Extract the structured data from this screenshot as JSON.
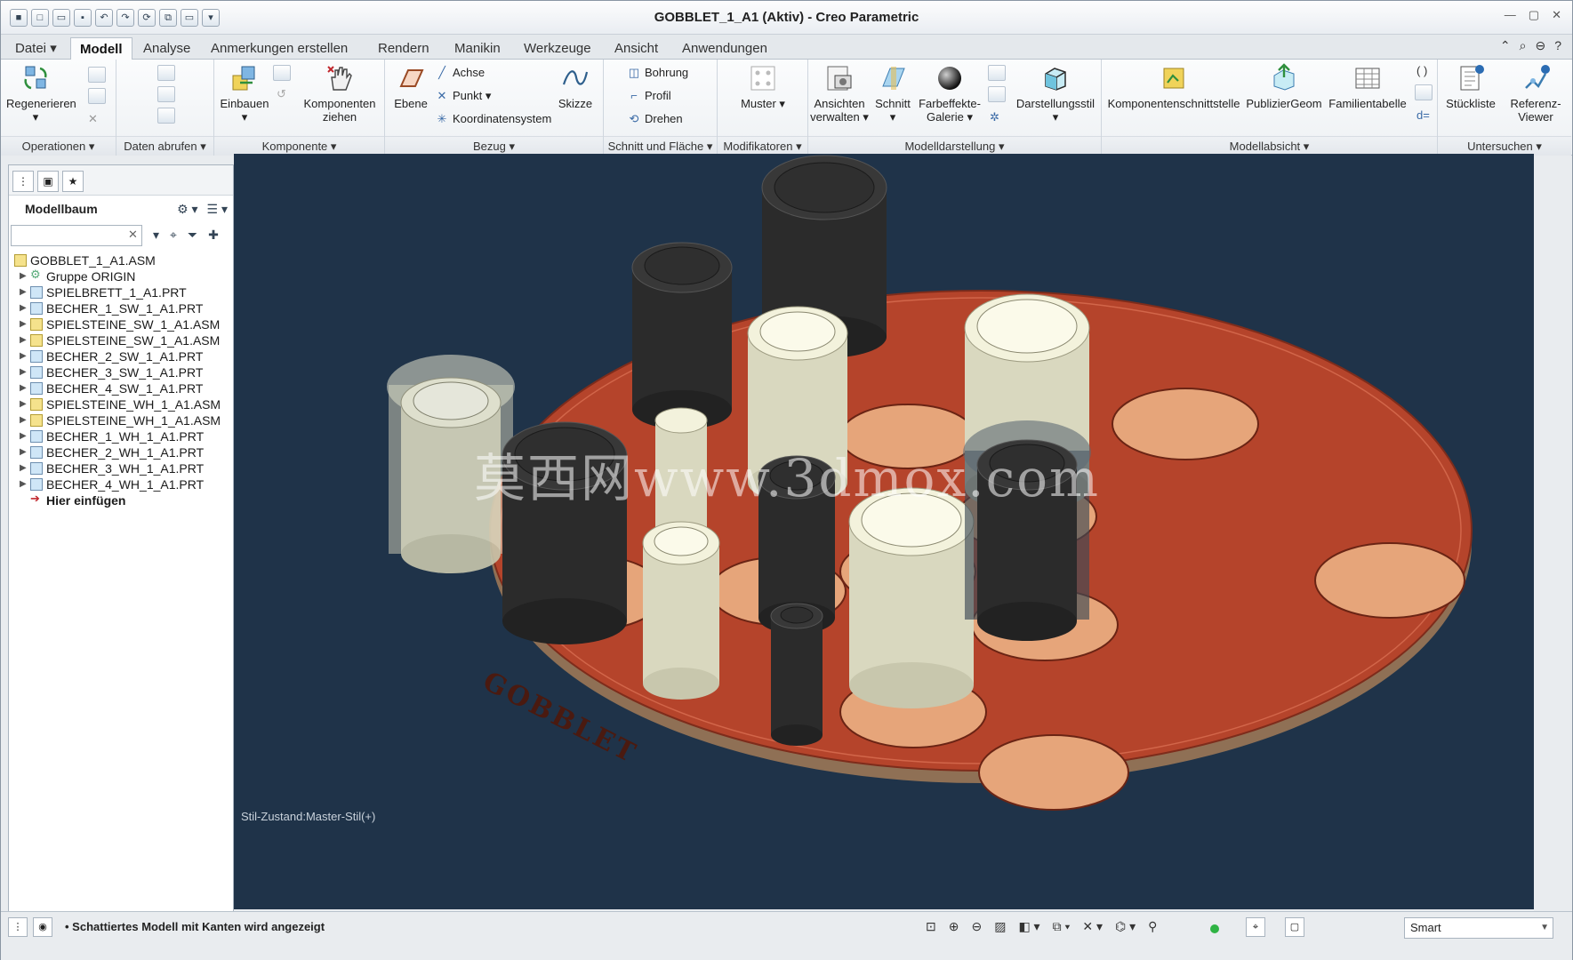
{
  "window": {
    "title": "GOBBLET_1_A1 (Aktiv) - Creo Parametric",
    "controls": [
      "—",
      "▢",
      "✕"
    ]
  },
  "tabs": [
    "Datei",
    "Modell",
    "Analyse",
    "Anmerkungen erstellen",
    "Rendern",
    "Manikin",
    "Werkzeuge",
    "Ansicht",
    "Anwendungen"
  ],
  "ribbon": {
    "groups": {
      "operationen": "Operationen",
      "daten": "Daten abrufen",
      "komponente": "Komponente",
      "bezug": "Bezug",
      "schnitt": "Schnitt und Fläche",
      "modifikatoren": "Modifikatoren",
      "modelldarstellung": "Modelldarstellung",
      "modellabsicht": "Modellabsicht",
      "untersuchen": "Untersuchen"
    },
    "buttons": {
      "regenerieren": "Regenerieren",
      "einbauen": "Einbauen",
      "komponenten_ziehen_1": "Komponenten",
      "komponenten_ziehen_2": "ziehen",
      "ebene": "Ebene",
      "achse": "Achse",
      "punkt": "Punkt",
      "koordinatensystem": "Koordinatensystem",
      "skizze": "Skizze",
      "bohrung": "Bohrung",
      "profil": "Profil",
      "drehen": "Drehen",
      "muster": "Muster",
      "ansichten_1": "Ansichten",
      "ansichten_2": "verwalten",
      "schnitt": "Schnitt",
      "farbeffekte_1": "Farbeffekte-",
      "farbeffekte_2": "Galerie",
      "darstellungsstil": "Darstellungsstil",
      "komponentenschnittstelle": "Komponentenschnittstelle",
      "publiziergeom": "PublizierGeom",
      "familientabelle": "Familientabelle",
      "stueckliste": "Stückliste",
      "referenz_1": "Referenz-",
      "referenz_2": "Viewer"
    }
  },
  "modelltree": {
    "title": "Modellbaum",
    "search_value": "",
    "items": [
      {
        "label": "GOBBLET_1_A1.ASM",
        "kind": "root"
      },
      {
        "label": "Gruppe ORIGIN",
        "kind": "group"
      },
      {
        "label": "SPIELBRETT_1_A1.PRT",
        "kind": "part"
      },
      {
        "label": "BECHER_1_SW_1_A1.PRT",
        "kind": "part"
      },
      {
        "label": "SPIELSTEINE_SW_1_A1.ASM",
        "kind": "asm"
      },
      {
        "label": "SPIELSTEINE_SW_1_A1.ASM",
        "kind": "asm"
      },
      {
        "label": "BECHER_2_SW_1_A1.PRT",
        "kind": "part"
      },
      {
        "label": "BECHER_3_SW_1_A1.PRT",
        "kind": "part"
      },
      {
        "label": "BECHER_4_SW_1_A1.PRT",
        "kind": "part"
      },
      {
        "label": "SPIELSTEINE_WH_1_A1.ASM",
        "kind": "asm"
      },
      {
        "label": "SPIELSTEINE_WH_1_A1.ASM",
        "kind": "asm"
      },
      {
        "label": "BECHER_1_WH_1_A1.PRT",
        "kind": "part"
      },
      {
        "label": "BECHER_2_WH_1_A1.PRT",
        "kind": "part"
      },
      {
        "label": "BECHER_3_WH_1_A1.PRT",
        "kind": "part"
      },
      {
        "label": "BECHER_4_WH_1_A1.PRT",
        "kind": "part"
      },
      {
        "label": "Hier einfügen",
        "kind": "insert"
      }
    ]
  },
  "viewport": {
    "style_state": "Stil-Zustand:Master-Stil(+)",
    "board_label": "GOBBLET",
    "watermark": "莫西网www.3dmox.com",
    "colors": {
      "background": "#1f3349",
      "board": "#b5442b",
      "board_edge": "#8f7055",
      "recess": "#e6a57a",
      "black_piece": "#2b2b2b",
      "white_piece": "#d9d8bf"
    }
  },
  "status": {
    "message": "Schattiertes Modell mit Kanten wird angezeigt",
    "filter": "Smart"
  }
}
